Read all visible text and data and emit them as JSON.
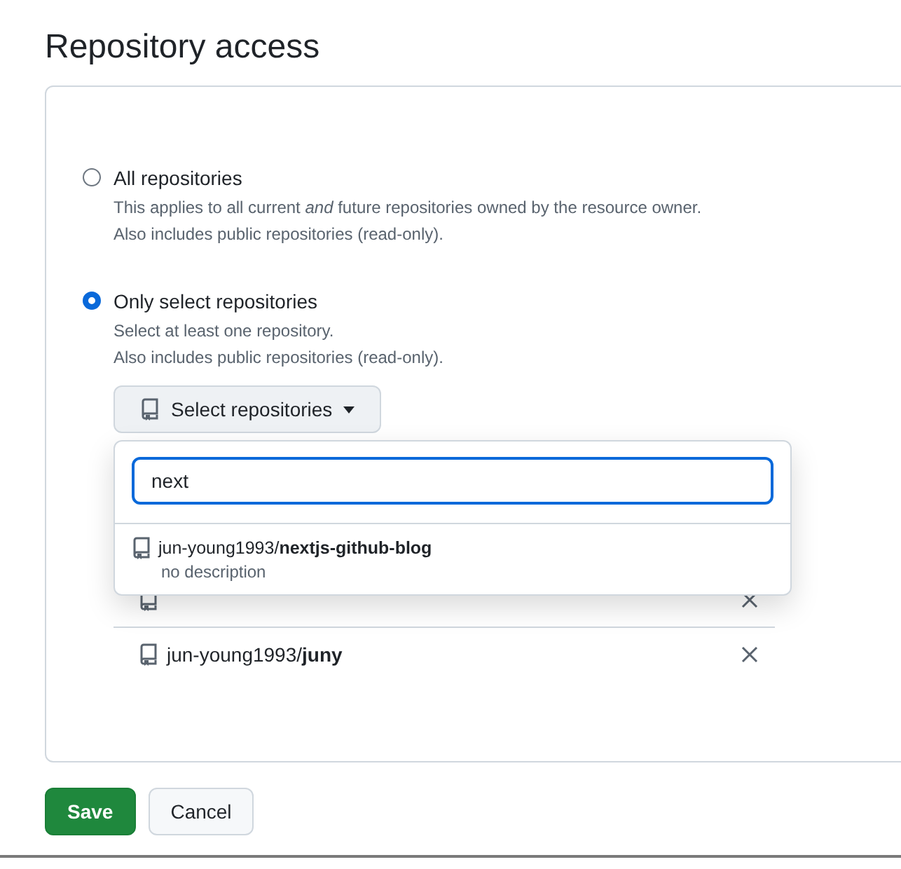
{
  "title": "Repository access",
  "options": [
    {
      "label": "All repositories",
      "description_lines": [
        "This applies to all current *and* future repositories owned by the resource owner.",
        "Also includes public repositories (read-only)."
      ],
      "selected": false
    },
    {
      "label": "Only select repositories",
      "description_lines": [
        "Select at least one repository.",
        "Also includes public repositories (read-only)."
      ],
      "selected": true
    }
  ],
  "select_button": {
    "label": "Select repositories"
  },
  "search": {
    "value": "next"
  },
  "results": [
    {
      "owner": "jun-young1993/",
      "name": "nextjs-github-blog",
      "description": "no description"
    }
  ],
  "selected_repositories": [
    {
      "owner": "jun-young1993/",
      "name": "juny"
    }
  ],
  "buttons": [
    {
      "label": "Save",
      "kind": "primary"
    },
    {
      "label": "Cancel",
      "kind": "secondary"
    }
  ]
}
